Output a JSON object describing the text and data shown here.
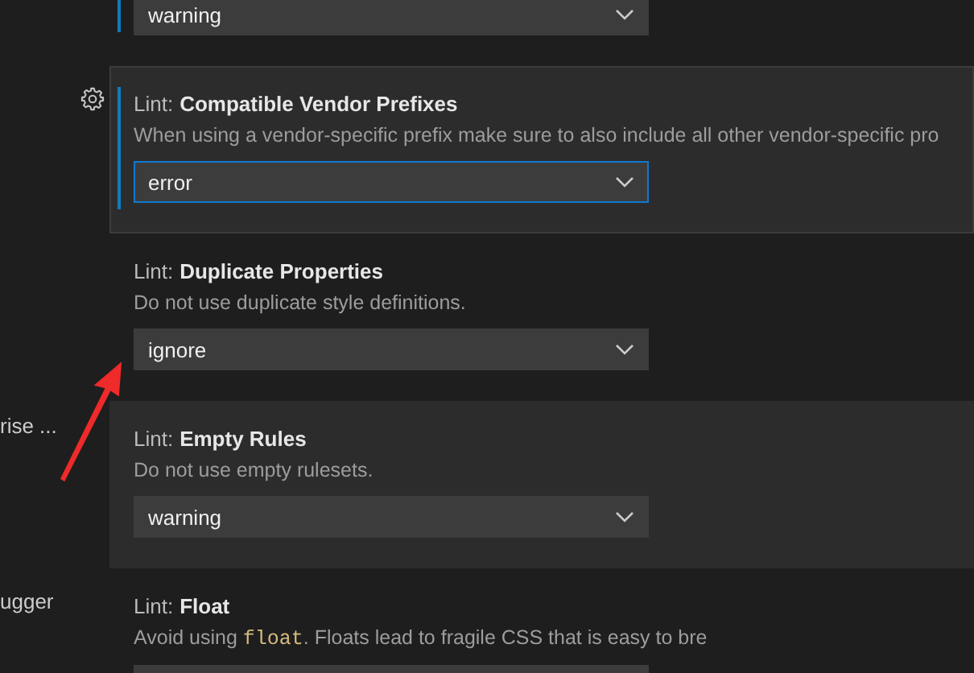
{
  "sidebar": {
    "items": [
      {
        "label": "rise ..."
      },
      {
        "label": "ugger"
      }
    ]
  },
  "settings": [
    {
      "dropdown": {
        "value": "warning"
      },
      "modified": true,
      "focused": false,
      "hovered": false
    },
    {
      "category": "Lint:",
      "title": "Compatible Vendor Prefixes",
      "description": [
        {
          "kind": "text",
          "text": "When using a vendor-specific prefix make sure to also include all other vendor-specific pro"
        }
      ],
      "dropdown": {
        "value": "error"
      },
      "modified": true,
      "focused": true,
      "hovered": true
    },
    {
      "category": "Lint:",
      "title": "Duplicate Properties",
      "description": [
        {
          "kind": "text",
          "text": "Do not use duplicate style definitions."
        }
      ],
      "dropdown": {
        "value": "ignore"
      },
      "modified": false,
      "focused": false,
      "hovered": false
    },
    {
      "category": "Lint:",
      "title": "Empty Rules",
      "description": [
        {
          "kind": "text",
          "text": "Do not use empty rulesets."
        }
      ],
      "dropdown": {
        "value": "warning"
      },
      "modified": false,
      "focused": false,
      "hovered": true
    },
    {
      "category": "Lint:",
      "title": "Float",
      "description": [
        {
          "kind": "text",
          "text": "Avoid using "
        },
        {
          "kind": "code",
          "text": "float"
        },
        {
          "kind": "text",
          "text": ". Floats lead to fragile CSS that is easy to bre"
        }
      ],
      "modified": false,
      "focused": false,
      "hovered": false
    }
  ]
}
